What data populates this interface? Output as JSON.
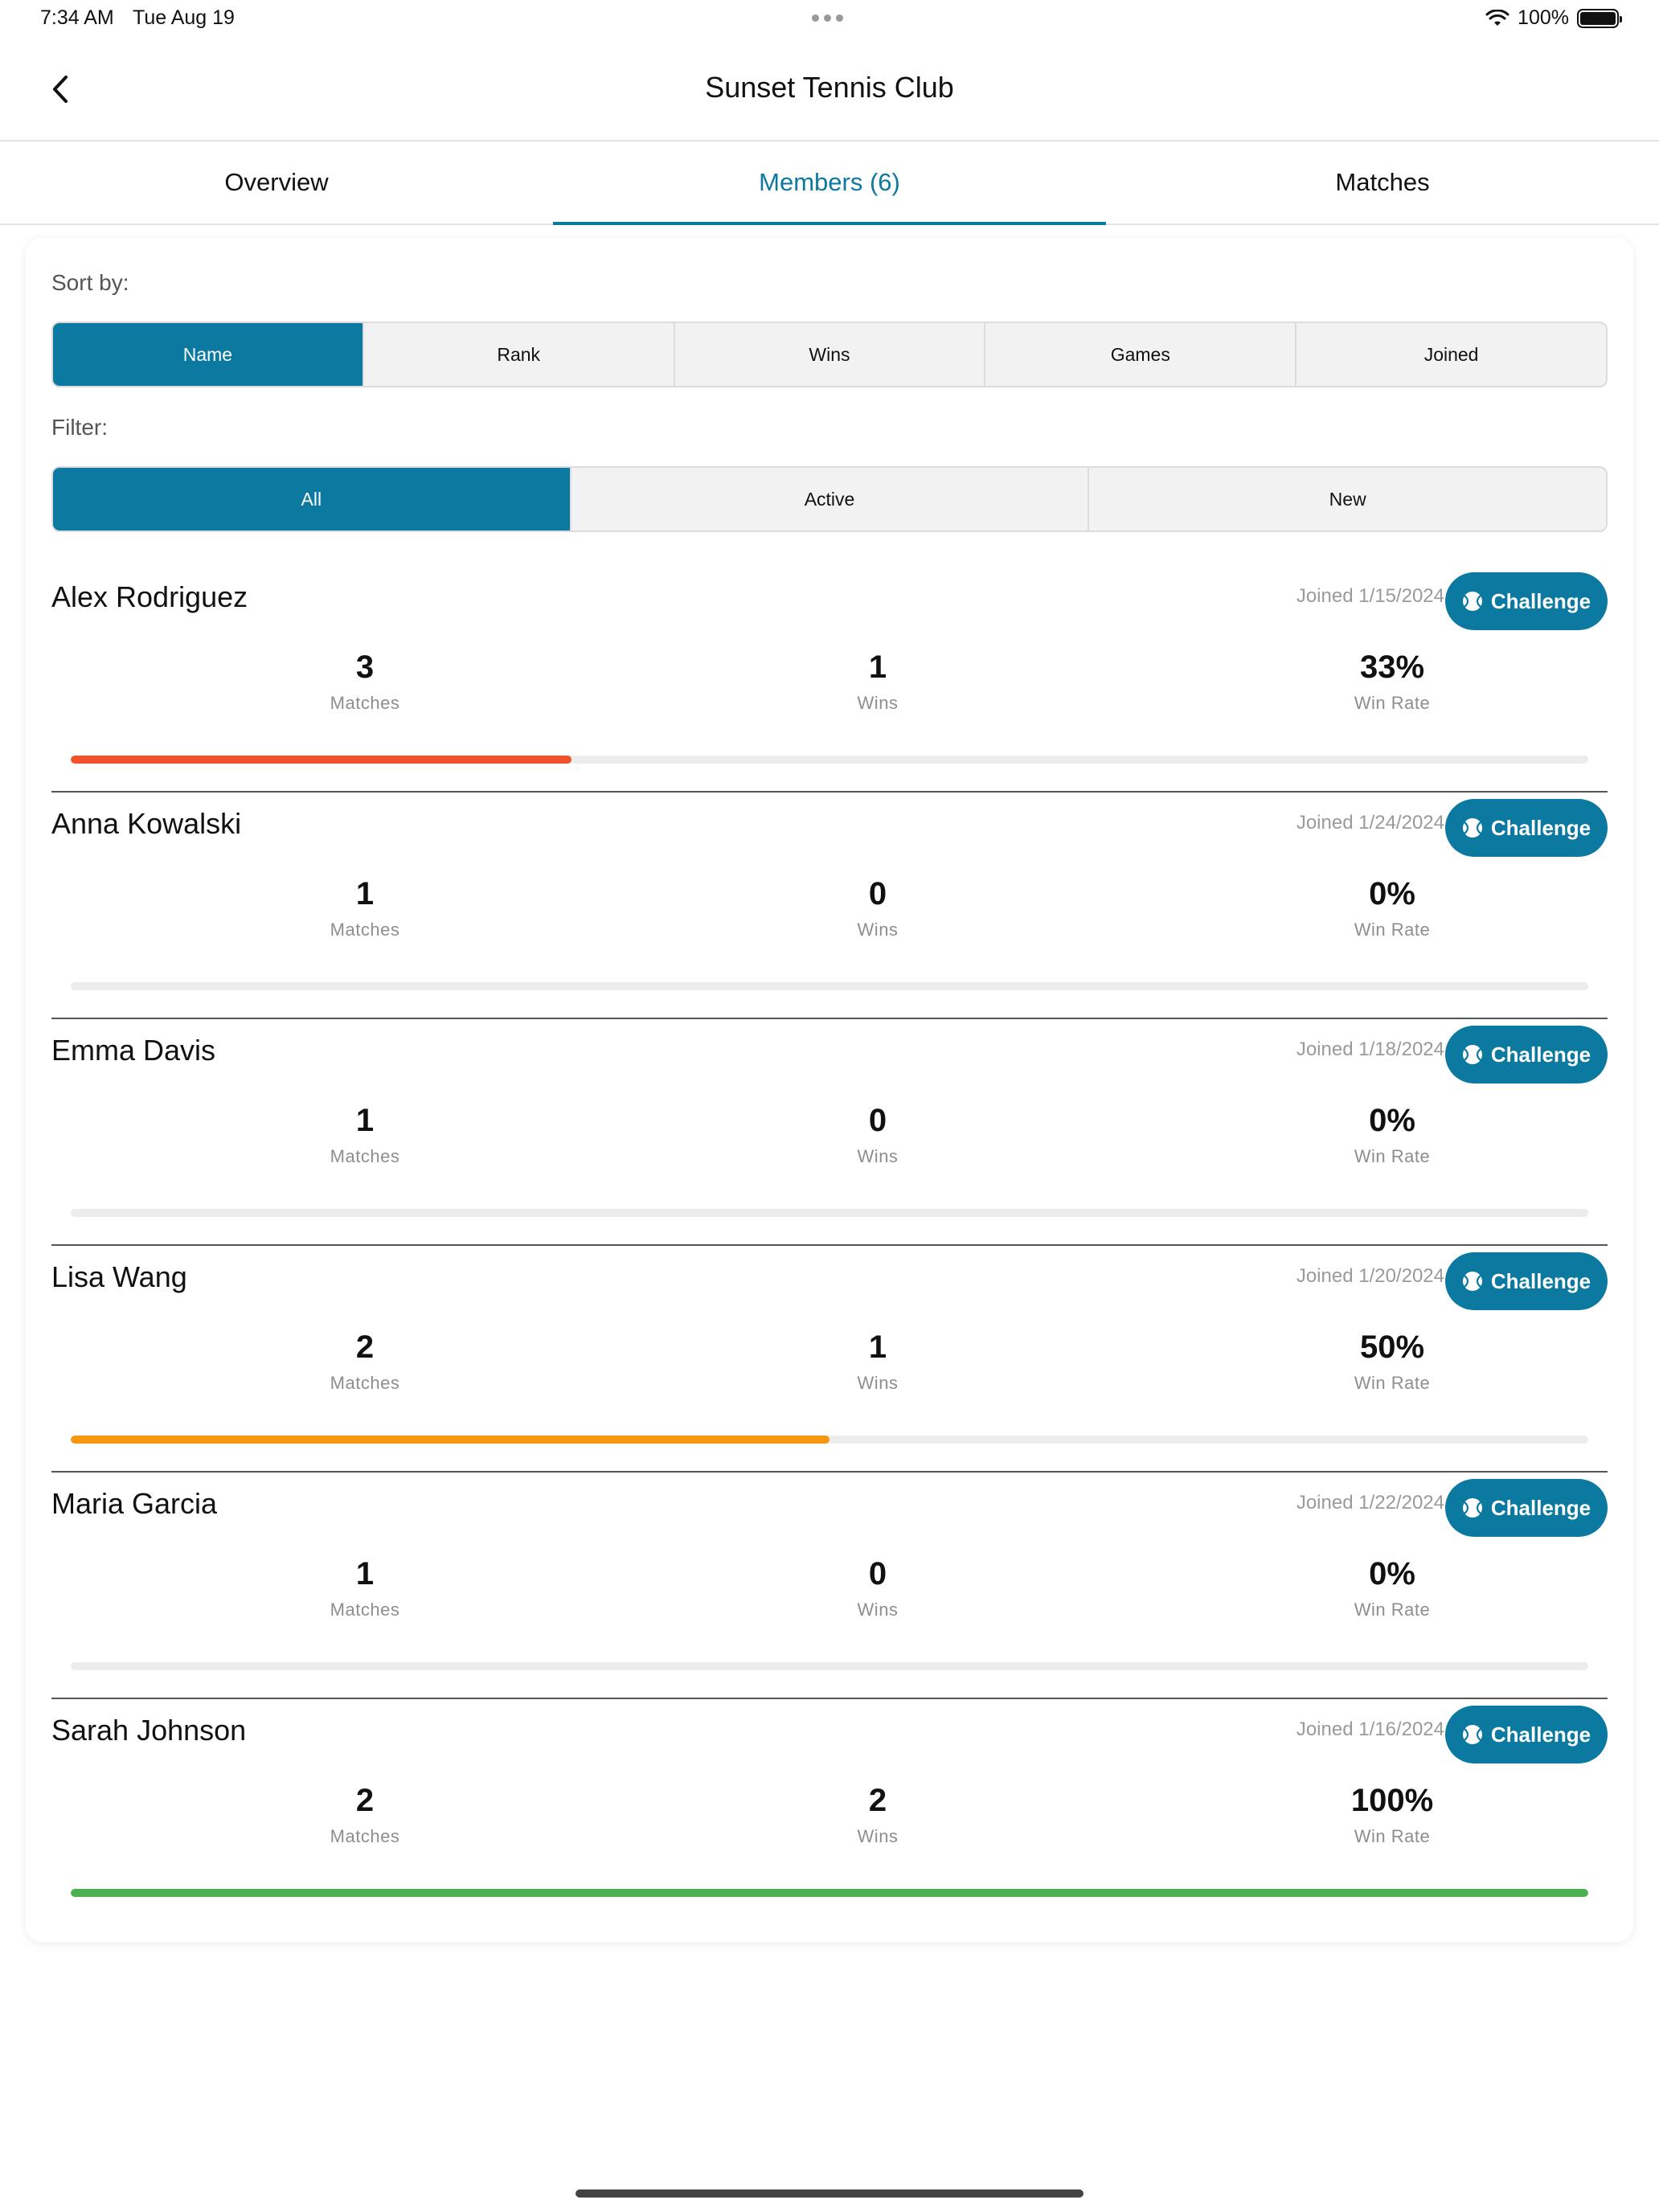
{
  "status_bar": {
    "time": "7:34 AM",
    "date": "Tue Aug 19",
    "battery": "100%"
  },
  "header": {
    "title": "Sunset Tennis Club"
  },
  "tabs": [
    {
      "label": "Overview",
      "active": false
    },
    {
      "label": "Members (6)",
      "active": true
    },
    {
      "label": "Matches",
      "active": false
    }
  ],
  "sort": {
    "label": "Sort by:",
    "options": [
      "Name",
      "Rank",
      "Wins",
      "Games",
      "Joined"
    ],
    "selected": "Name"
  },
  "filter": {
    "label": "Filter:",
    "options": [
      "All",
      "Active",
      "New"
    ],
    "selected": "All"
  },
  "labels": {
    "matches": "Matches",
    "wins": "Wins",
    "win_rate": "Win Rate",
    "challenge": "Challenge"
  },
  "colors": {
    "accent": "#0c79a0",
    "low": "#f0522b",
    "mid": "#f7960f",
    "high": "#4caf50",
    "track": "#ececec"
  },
  "members": [
    {
      "name": "Alex Rodriguez",
      "joined": "Joined 1/15/2024",
      "matches": "3",
      "wins": "1",
      "win_rate": "33%",
      "win_fraction": 0.33,
      "bar_color": "#f0522b"
    },
    {
      "name": "Anna Kowalski",
      "joined": "Joined 1/24/2024",
      "matches": "1",
      "wins": "0",
      "win_rate": "0%",
      "win_fraction": 0,
      "bar_color": "#f0522b"
    },
    {
      "name": "Emma Davis",
      "joined": "Joined 1/18/2024",
      "matches": "1",
      "wins": "0",
      "win_rate": "0%",
      "win_fraction": 0,
      "bar_color": "#f0522b"
    },
    {
      "name": "Lisa Wang",
      "joined": "Joined 1/20/2024",
      "matches": "2",
      "wins": "1",
      "win_rate": "50%",
      "win_fraction": 0.5,
      "bar_color": "#f7960f"
    },
    {
      "name": "Maria Garcia",
      "joined": "Joined 1/22/2024",
      "matches": "1",
      "wins": "0",
      "win_rate": "0%",
      "win_fraction": 0,
      "bar_color": "#f0522b"
    },
    {
      "name": "Sarah Johnson",
      "joined": "Joined 1/16/2024",
      "matches": "2",
      "wins": "2",
      "win_rate": "100%",
      "win_fraction": 1.0,
      "bar_color": "#4caf50"
    }
  ]
}
